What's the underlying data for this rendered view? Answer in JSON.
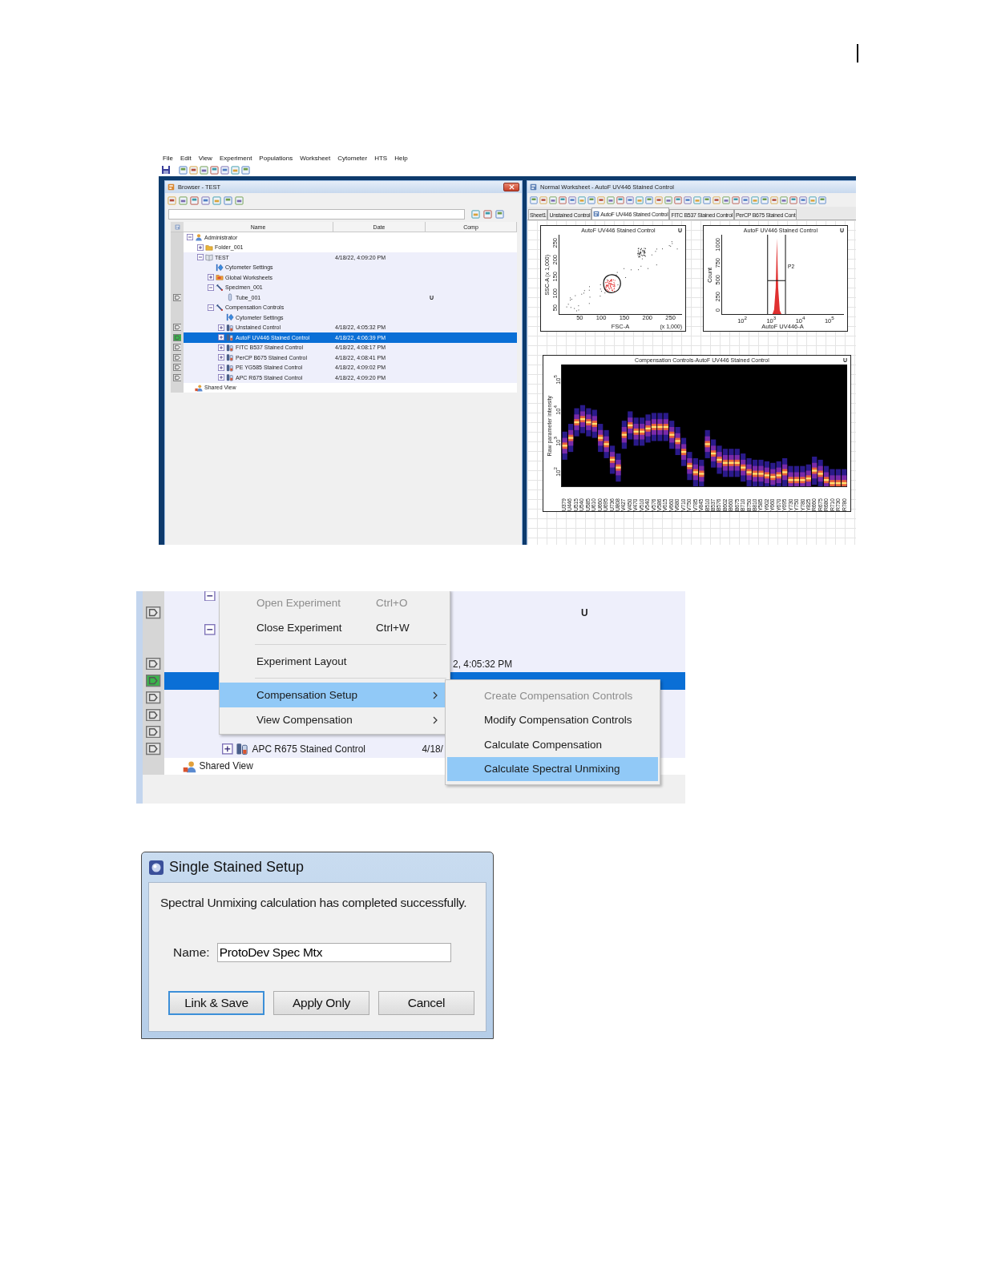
{
  "app_window": {
    "menu": [
      "File",
      "Edit",
      "View",
      "Experiment",
      "Populations",
      "Worksheet",
      "Cytometer",
      "HTS",
      "Help"
    ],
    "browser": {
      "title": "Browser - TEST",
      "columns": [
        "Name",
        "Date",
        "Comp"
      ],
      "tree": [
        {
          "kind": "user",
          "name": "Administrator",
          "expanded": true,
          "selected": false,
          "children": [
            {
              "kind": "folder",
              "name": "Folder_001",
              "expanded": false,
              "selected": false
            },
            {
              "kind": "experiment",
              "name": "TEST",
              "date": "4/18/22, 4:09:20 PM",
              "expanded": true,
              "selected": false,
              "children": [
                {
                  "kind": "settings",
                  "name": "Cytometer Settings",
                  "selected": false
                },
                {
                  "kind": "worksheets",
                  "name": "Global Worksheets",
                  "expanded": false,
                  "selected": false
                },
                {
                  "kind": "specimen",
                  "name": "Specimen_001",
                  "expanded": true,
                  "selected": false,
                  "children": [
                    {
                      "kind": "tube",
                      "name": "Tube_001",
                      "comp": "U",
                      "pointer_current": false,
                      "selected": false
                    }
                  ]
                },
                {
                  "kind": "specimen",
                  "name": "Compensation Controls",
                  "expanded": true,
                  "selected": false,
                  "children": [
                    {
                      "kind": "settings",
                      "name": "Cytometer Settings",
                      "selected": false
                    },
                    {
                      "kind": "control",
                      "name": "Unstained Control",
                      "date": "4/18/22, 4:05:32 PM",
                      "expanded": false,
                      "pointer_current": false,
                      "selected": false
                    },
                    {
                      "kind": "control",
                      "name": "AutoF UV446 Stained Control",
                      "date": "4/18/22, 4:06:39 PM",
                      "expanded": false,
                      "pointer_current": true,
                      "selected": true
                    },
                    {
                      "kind": "control",
                      "name": "FITC B537 Stained Control",
                      "date": "4/18/22, 4:08:17 PM",
                      "expanded": false,
                      "pointer_current": false,
                      "selected": false
                    },
                    {
                      "kind": "control",
                      "name": "PerCP B675 Stained Control",
                      "date": "4/18/22, 4:08:41 PM",
                      "expanded": false,
                      "pointer_current": false,
                      "selected": false
                    },
                    {
                      "kind": "control",
                      "name": "PE YG585 Stained Control",
                      "date": "4/18/22, 4:09:02 PM",
                      "expanded": false,
                      "pointer_current": false,
                      "selected": false
                    },
                    {
                      "kind": "control",
                      "name": "APC R675 Stained Control",
                      "date": "4/18/22, 4:09:20 PM",
                      "expanded": false,
                      "pointer_current": false,
                      "selected": false
                    }
                  ]
                }
              ]
            }
          ]
        },
        {
          "kind": "shared",
          "name": "Shared View",
          "selected": false
        }
      ]
    },
    "worksheet": {
      "title": "Normal Worksheet - AutoF UV446 Stained Control",
      "tabs": [
        {
          "label": "Sheet1",
          "selected": false
        },
        {
          "label": "Unstained Control",
          "selected": false
        },
        {
          "label": "AutoF UV446 Stained Control",
          "selected": true
        },
        {
          "label": "FITC B537 Stained Control",
          "selected": false
        },
        {
          "label": "PerCP B675 Stained Cont",
          "selected": false
        }
      ],
      "plots": [
        {
          "kind": "scatter",
          "title": "AutoF UV446 Stained Control",
          "corner": "U",
          "xlabel": "FSC-A",
          "ylabel": "SSC-A (x 1,000)",
          "scale_note": "(x 1,000)",
          "xticks": [
            "50",
            "100",
            "150",
            "200",
            "250"
          ],
          "yticks": [
            "50",
            "100",
            "150",
            "200",
            "250"
          ]
        },
        {
          "kind": "histogram",
          "title": "AutoF UV446 Stained Control",
          "corner": "U",
          "xlabel": "AutoF UV446-A",
          "ylabel": "Count",
          "gate": "P2",
          "xticks": [
            "10$^{2}$",
            "10$^{3}$",
            "10$^{4}$",
            "10$^{5}$"
          ],
          "yticks": [
            "0",
            "250",
            "500",
            "750",
            "1000"
          ]
        },
        {
          "kind": "heatmap",
          "title": "Compensation Controls-AutoF UV446 Stained Control",
          "corner": "U",
          "ylabel": "Raw parameter intensity",
          "yticks": [
            "10$^{2}$",
            "10$^{3}$",
            "10$^{4}$",
            "10$^{5}$"
          ],
          "categories": [
            "U379",
            "U446",
            "U515",
            "U540",
            "U585",
            "U610",
            "U660",
            "U695",
            "U736",
            "U808",
            "V427",
            "V450",
            "V470",
            "V510",
            "V540",
            "V576",
            "V586",
            "V615",
            "V660",
            "V680",
            "V710",
            "V750",
            "V785",
            "V845",
            "B510",
            "B537",
            "B576",
            "B602",
            "B660",
            "B675",
            "B710",
            "B750",
            "B810",
            "Y585",
            "Y602",
            "Y660",
            "Y670",
            "Y695",
            "Y730",
            "Y750",
            "Y780",
            "Y825",
            "R660",
            "R675",
            "R680",
            "R710",
            "R730",
            "R780"
          ]
        }
      ]
    }
  },
  "context_menu_view": {
    "rows": [
      {
        "expanded": true,
        "selected": false,
        "children": [
          {
            "comp": "U",
            "pointer_current": false,
            "selected": false
          }
        ]
      },
      {
        "expanded": true,
        "selected": false,
        "children": [
          {
            "selected": false
          },
          {
            "date_partial": "2, 4:05:32 PM",
            "pointer_current": false,
            "selected": false
          },
          {
            "pointer_current": true,
            "selected": true
          },
          {
            "pointer_current": false,
            "selected": false
          },
          {
            "pointer_current": false,
            "selected": false
          },
          {
            "pointer_current": false,
            "selected": false
          },
          {
            "kind": "control",
            "name": "APC R675 Stained Control",
            "date": "4/18/",
            "expanded": false,
            "pointer_current": false,
            "selected": false
          }
        ]
      },
      {
        "kind": "shared",
        "name": "Shared View",
        "selected": false
      }
    ],
    "menu": [
      {
        "kind": "item",
        "label": "Open Experiment",
        "shortcut": "Ctrl+O",
        "disabled": true,
        "selected": false
      },
      {
        "kind": "item",
        "label": "Close Experiment",
        "shortcut": "Ctrl+W",
        "disabled": false,
        "selected": false
      },
      {
        "kind": "separator"
      },
      {
        "kind": "item",
        "label": "Experiment Layout",
        "disabled": false,
        "selected": false
      },
      {
        "kind": "separator"
      },
      {
        "kind": "item",
        "label": "Compensation Setup",
        "submenu": true,
        "disabled": false,
        "selected": true
      },
      {
        "kind": "item",
        "label": "View Compensation",
        "submenu": true,
        "disabled": false,
        "selected": false
      }
    ],
    "submenu": [
      {
        "label": "Create Compensation Controls",
        "disabled": true,
        "selected": false
      },
      {
        "label": "Modify Compensation Controls",
        "disabled": false,
        "selected": false
      },
      {
        "label": "Calculate Compensation",
        "disabled": false,
        "selected": false
      },
      {
        "label": "Calculate Spectral Unmixing",
        "disabled": false,
        "selected": true
      }
    ]
  },
  "dialog": {
    "title": "Single Stained Setup",
    "message": "Spectral Unmixing calculation has completed successfully.",
    "name_label": "Name:",
    "name_value": "ProtoDev Spec Mtx",
    "buttons": [
      {
        "label": "Link & Save",
        "selected": true
      },
      {
        "label": "Apply Only",
        "selected": false
      },
      {
        "label": "Cancel",
        "selected": false
      }
    ]
  }
}
